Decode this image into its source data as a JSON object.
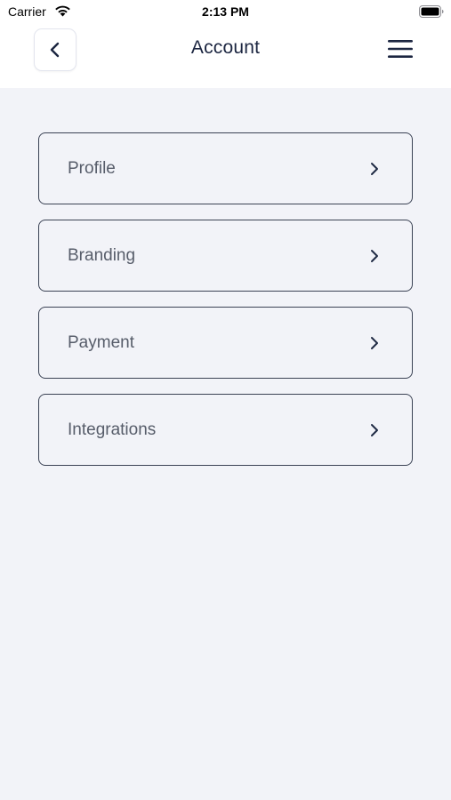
{
  "status_bar": {
    "carrier": "Carrier",
    "time": "2:13 PM",
    "icons": [
      "wifi-icon",
      "battery-icon"
    ]
  },
  "header": {
    "title": "Account",
    "back_icon": "chevron-left-icon",
    "menu_icon": "hamburger-menu-icon"
  },
  "menu": {
    "items": [
      {
        "label": "Profile",
        "icon": "chevron-right-icon"
      },
      {
        "label": "Branding",
        "icon": "chevron-right-icon"
      },
      {
        "label": "Payment",
        "icon": "chevron-right-icon"
      },
      {
        "label": "Integrations",
        "icon": "chevron-right-icon"
      }
    ]
  },
  "colors": {
    "background": "#f2f3f8",
    "header_background": "#ffffff",
    "text_primary": "#1b2540",
    "item_label": "#575d6a",
    "item_border": "#3a4254"
  }
}
